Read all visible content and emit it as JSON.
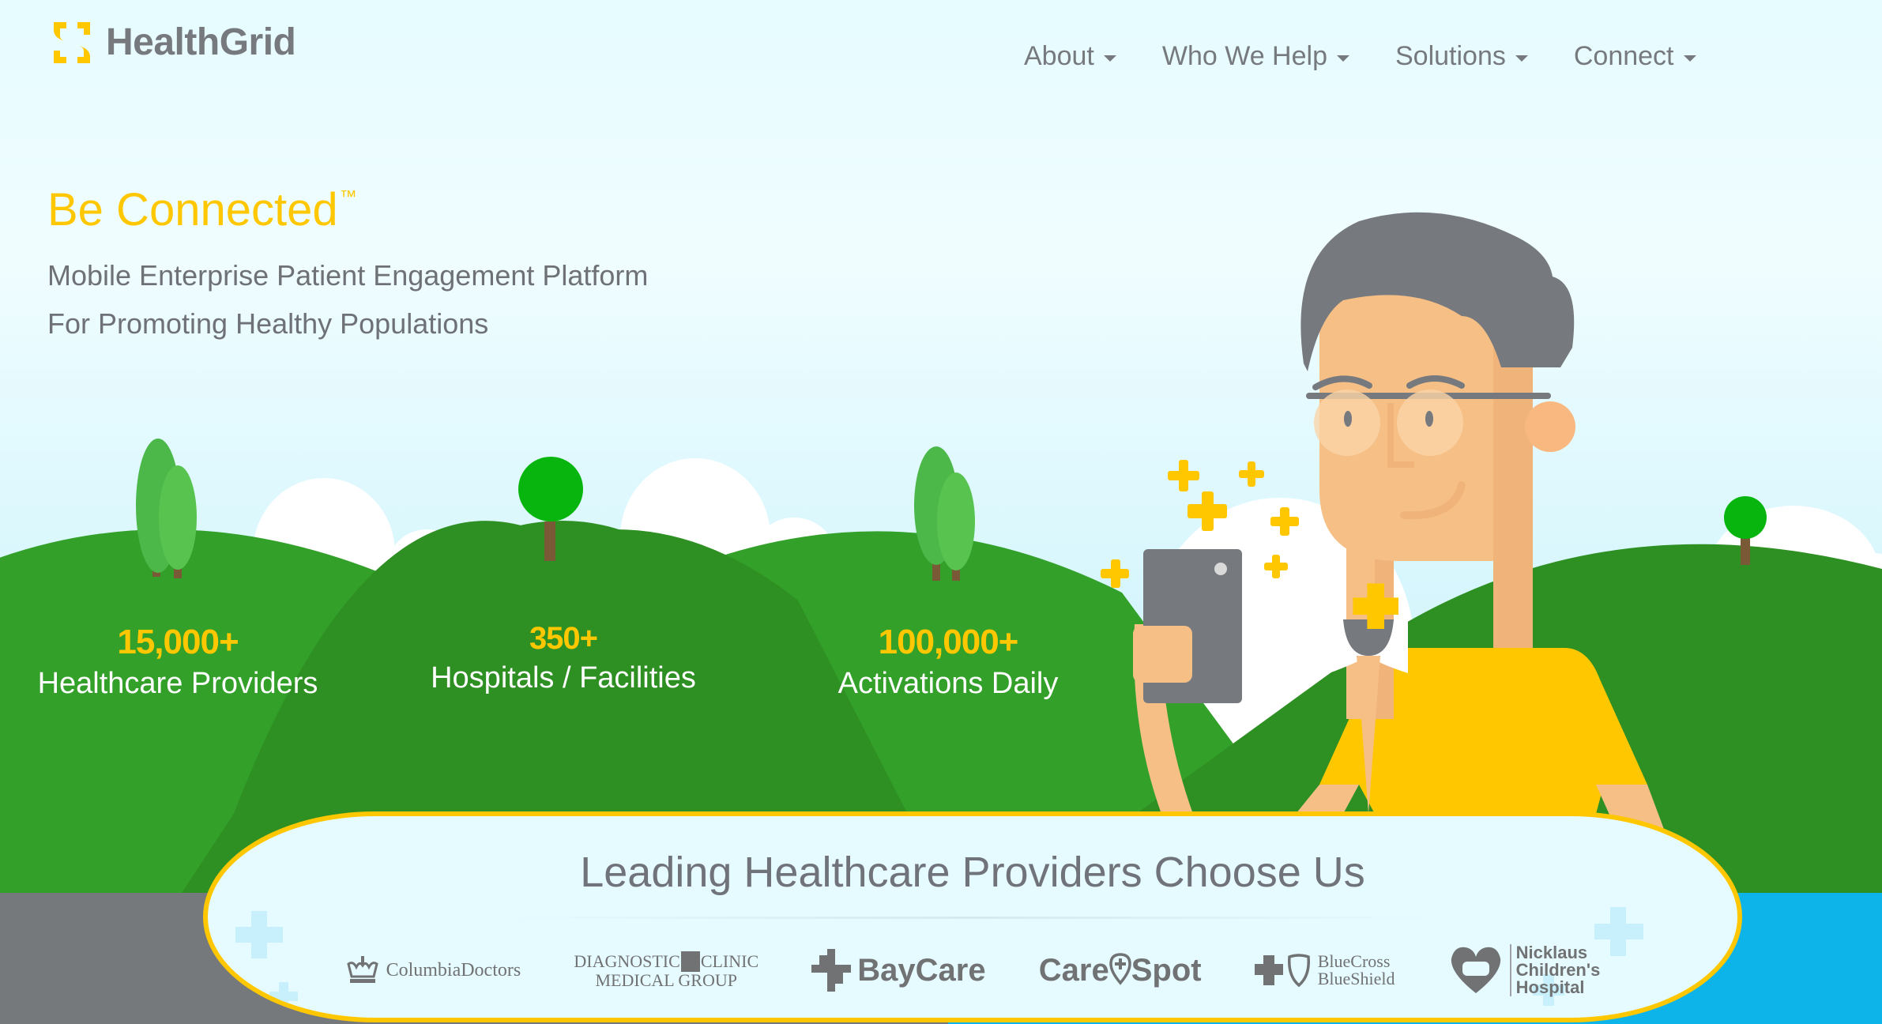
{
  "brand": {
    "name": "HealthGrid",
    "logo_icon": "healthgrid-s-logo-icon",
    "accent_color": "#ffc700",
    "text_color": "#76797e"
  },
  "nav": {
    "items": [
      {
        "label": "About",
        "icon": "caret-down-icon"
      },
      {
        "label": "Who We Help",
        "icon": "caret-down-icon"
      },
      {
        "label": "Solutions",
        "icon": "caret-down-icon"
      },
      {
        "label": "Connect",
        "icon": "caret-down-icon"
      }
    ]
  },
  "hero": {
    "title": "Be Connected",
    "trademark": "™",
    "subtitle_line1": "Mobile Enterprise Patient Engagement Platform",
    "subtitle_line2": "For Promoting Healthy Populations"
  },
  "stats": [
    {
      "value": "15,000+",
      "label": "Healthcare Providers"
    },
    {
      "value": "350+",
      "label": "Hospitals / Facilities"
    },
    {
      "value": "100,000+",
      "label": "Activations Daily"
    }
  ],
  "partners": {
    "heading": "Leading Healthcare Providers Choose Us",
    "logos": [
      {
        "name": "ColumbiaDoctors",
        "icon": "crown-icon"
      },
      {
        "name_line1": "DIAGNOSTIC",
        "name_mid": "CLINIC",
        "name_line2": "MEDICAL GROUP",
        "icon": "caduceus-cross-icon"
      },
      {
        "name": "BayCare",
        "icon": "baycare-cross-icon"
      },
      {
        "name_left": "Care",
        "name_right": "Spot",
        "icon": "location-pin-cross-icon"
      },
      {
        "name_line1": "BlueCross",
        "name_line2": "BlueShield",
        "icon": "bluecross-blueshield-icon"
      },
      {
        "name_line1": "Nicklaus",
        "name_line2": "Children's",
        "name_line3": "Hospital",
        "icon": "heart-bear-icon"
      }
    ]
  },
  "colors": {
    "sky": "#dff8fd",
    "grass_light": "#33a02a",
    "grass_dark": "#2e9022",
    "shirt": "#ffc700",
    "skin": "#f5bf85",
    "hair": "#76797e",
    "strip_gray": "#76797c",
    "strip_blue": "#0db4ea"
  }
}
